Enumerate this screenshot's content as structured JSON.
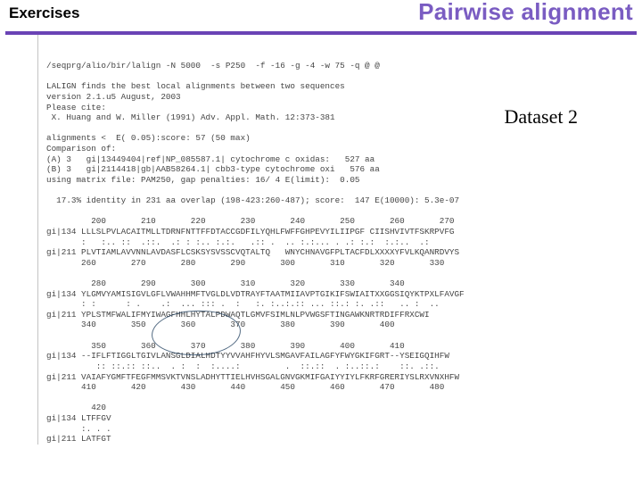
{
  "header": {
    "left": "Exercises",
    "right": "Pairwise alignment"
  },
  "callout": "Dataset 2",
  "terminal": {
    "cmd": "/seqprg/alio/bir/lalign -N 5000  -s P250  -f -16 -g -4 -w 75 -q @ @",
    "intro1": "LALIGN finds the best local alignments between two sequences",
    "intro2": "version 2.1.u5 August, 2003",
    "cite1": "Please cite:",
    "cite2": " X. Huang and W. Miller (1991) Adv. Appl. Math. 12:373-381",
    "alns": "alignments <  E( 0.05):score: 57 (50 max)",
    "comp": "Comparison of:",
    "a": "(A) 3   gi|13449404|ref|NP_085587.1| cytochrome c oxidas:   527 aa",
    "b": "(B) 3   gi|2114418|gb|AAB58264.1| cbb3-type cytochrome oxi   576 aa",
    "matrix": "using matrix file: PAM250, gap penalties: 16/ 4 E(limit):  0.05",
    "ident": "  17.3% identity in 231 aa overlap (198-423:260-487); score:  147 E(10000): 5.3e-07",
    "ruler1": "         200       210       220       230       240       250       260       270",
    "seqA1": "gi|134 LLLSLPVLACAITMLLTDRNFNTTFFDTACCGDFILYQHLFWFFGHPEVYILIIPGF CIISHVIVTFSKRPVFG",
    "match1": "       :   :.. ::  .::.  .: : :.. :.:.   .:: .  .. :.:... . .: :.:  :.:..  .:",
    "seqB1": "gi|211 PLVTIAMLAVVNNLAVDASFLCSKSYSVSSCVQTALTQ   WNYCHNAVGFPLTACFDLXXXXYFVLKQANRDVYS",
    "ruler1b": "       260       270       280       290       300       310       320       330",
    "ruler2": "         280       290       300       310       320       330       340",
    "seqA2": "gi|134 YLGMVYAMISIGVLGFLVWAHHMFTVGLDLVDTRAYFTAATMIIAVPTGIKIFSWIAITXXGGSIQYKTPXLFAVGF",
    "match2": "       : :      : .    .:  ... ::: .  :   :. :..:.:: ... ::.: :. .::   .. :  ..",
    "seqB2": "gi|211 YPLSTMFWALIFMYIWAGFHHLHYTALPDWAQTLGMVFSIMLNLPVWGSFTINGAWKNRTRDIFFRXCWI",
    "ruler2b": "       340       350       360       370       380       390       400",
    "ruler3": "         350       360       370       380       390       400       410",
    "seqA3": "gi|134 --IFLFTIGGLTGIVLANSGLDIALHDTYYVVAHFHYVLSMGAVFAILAGFYFWYGKIFGRT--YSEIGQIHFW",
    "match3": "          :: ::.:: ::..  . :  :  :....:         .  ::.::  . :..::.:    ::. .::.",
    "seqB3": "gi|211 VAIAFYGMFTFEGFMMSVKTVNSLADHYTTIELHVHSGALGNVGKMIFGAIYYIYLFKRFGRERIYSLRXVNXHFW",
    "ruler3b": "       410       420       430       440       450       460       470       480",
    "trailRuler": "         420",
    "trailA": "gi|134 LTFFGV",
    "trailM": "       :. . .",
    "trailB": "gi|211 LATFGT"
  }
}
